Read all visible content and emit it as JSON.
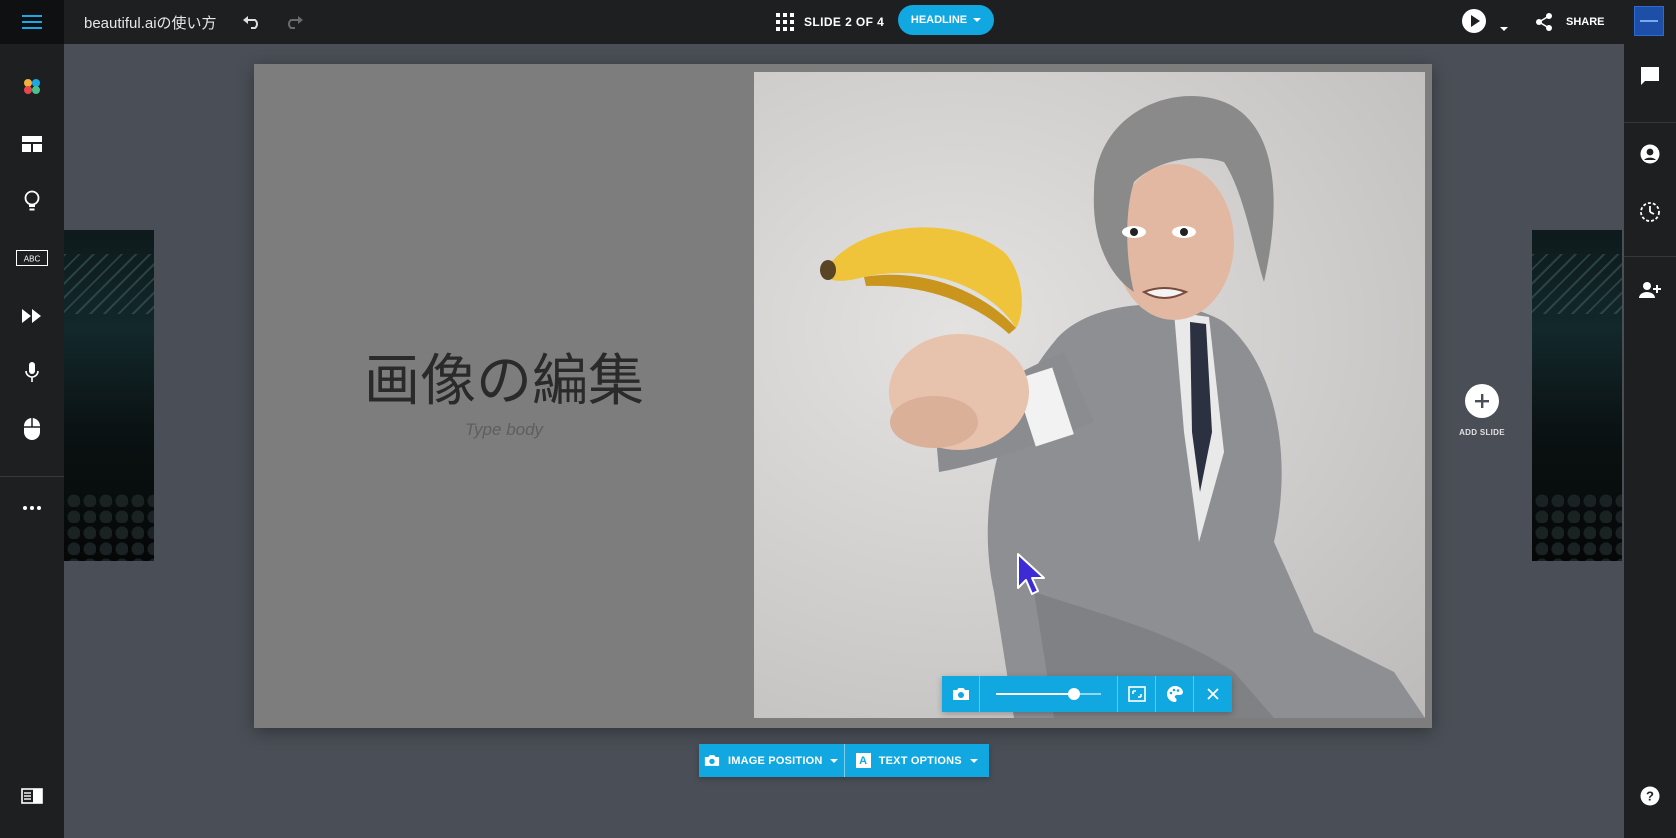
{
  "app": {
    "title": "beautiful.aiの使い方"
  },
  "topbar": {
    "slide_counter": "SLIDE 2 OF 4",
    "layout_button": "HEADLINE",
    "share_label": "SHARE"
  },
  "slide": {
    "title": "画像の編集",
    "body_placeholder": "Type body",
    "background_color": "#7d7d7d"
  },
  "image_toolbar": {
    "zoom_level": 0.74
  },
  "bottom_toolbar": {
    "image_position_label": "IMAGE POSITION",
    "text_options_label": "TEXT OPTIONS"
  },
  "add_slide": {
    "label": "ADD SLIDE"
  },
  "colors": {
    "accent": "#11a7e0",
    "chrome": "#1e1f21",
    "canvas": "#4a4f57"
  },
  "left_sidebar": {
    "icons": [
      "palette-icon",
      "layout-icon",
      "lightbulb-icon",
      "abc-icon",
      "animation-icon",
      "microphone-icon",
      "mouse-icon",
      "more-icon",
      "panel-icon"
    ]
  },
  "right_sidebar": {
    "icons": [
      "comment-icon",
      "user-circle-icon",
      "history-icon",
      "add-user-icon",
      "help-icon"
    ]
  }
}
